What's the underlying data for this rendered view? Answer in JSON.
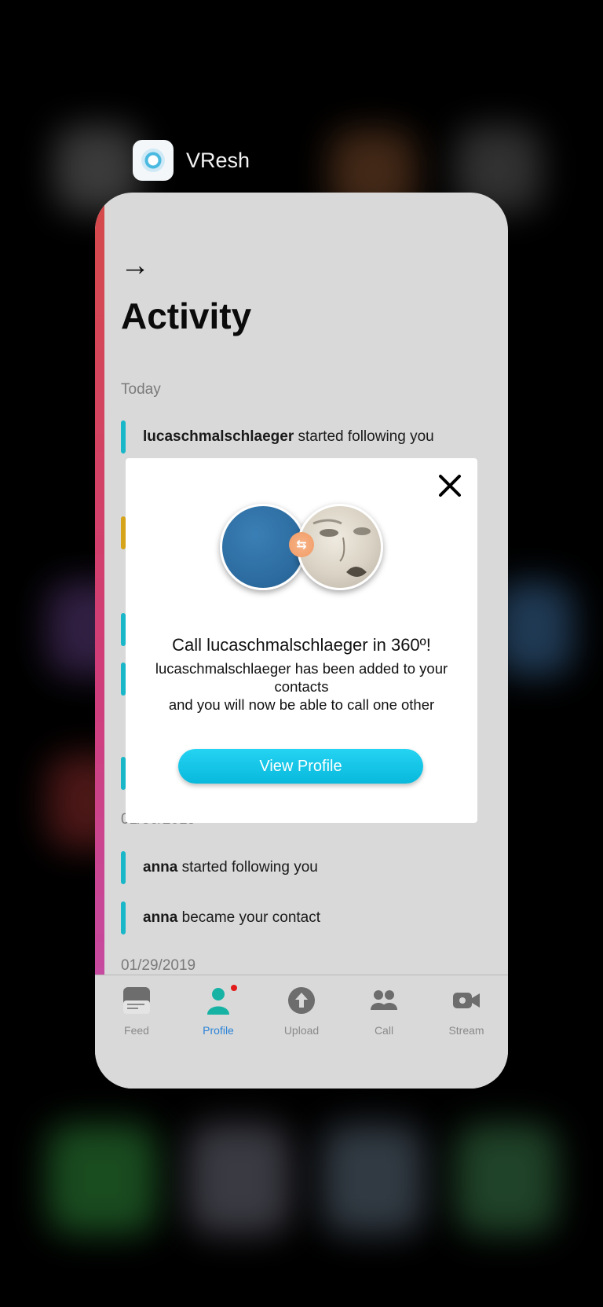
{
  "app_switcher": {
    "app_name": "VResh"
  },
  "activity": {
    "title": "Activity",
    "sections": [
      {
        "date": "Today",
        "items": [
          {
            "user": "lucaschmalschlaeger",
            "action": " started following you"
          }
        ]
      },
      {
        "date": "01/30/2019",
        "items": [
          {
            "user": "anna",
            "action": " started following you"
          },
          {
            "user": "anna",
            "action": " became your contact"
          }
        ]
      },
      {
        "date": "01/29/2019",
        "items": []
      }
    ]
  },
  "tabbar": {
    "tabs": [
      {
        "label": "Feed",
        "icon": "feed-icon"
      },
      {
        "label": "Profile",
        "icon": "profile-icon",
        "active": true,
        "badge": true
      },
      {
        "label": "Upload",
        "icon": "upload-icon"
      },
      {
        "label": "Call",
        "icon": "call-icon"
      },
      {
        "label": "Stream",
        "icon": "video-icon"
      }
    ]
  },
  "modal": {
    "title": "Call lucaschmalschlaeger in 360º!",
    "body_line1": "lucaschmalschlaeger has been added to your contacts",
    "body_line2": "and you will now be able to call one other",
    "button_label": "View Profile",
    "close_icon": "close-icon"
  },
  "colors": {
    "accent": "#19b7c8",
    "button": "#08b9dc",
    "active_tab": "#2a83d8",
    "card_bg": "#d9d9d9"
  }
}
